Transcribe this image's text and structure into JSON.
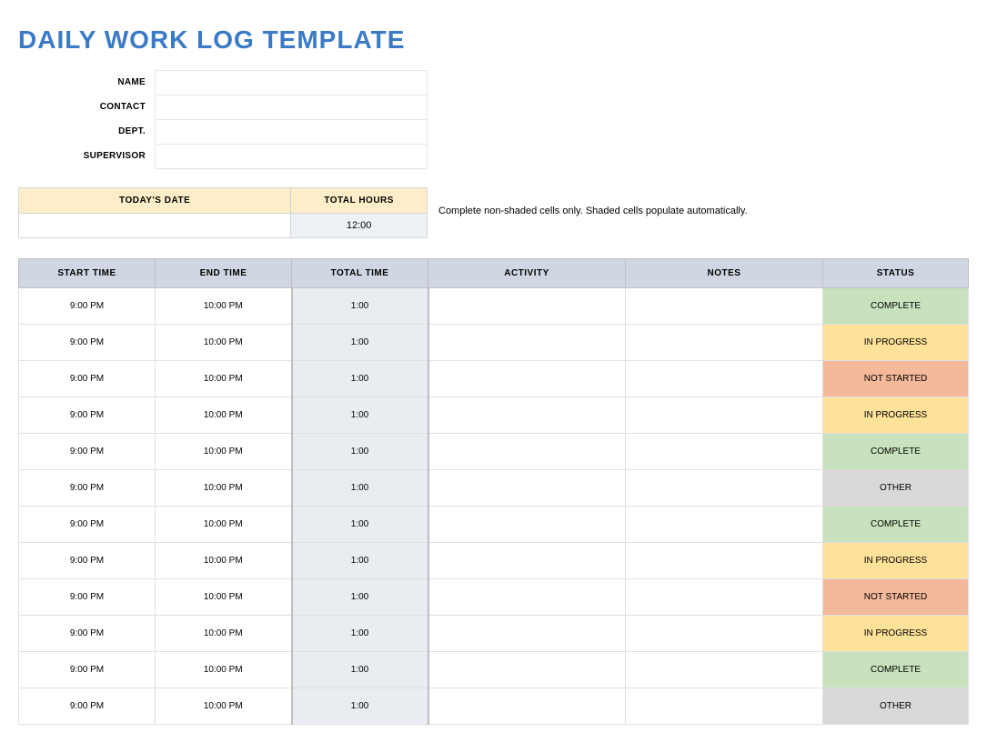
{
  "title": "DAILY WORK LOG TEMPLATE",
  "info": {
    "name_label": "NAME",
    "name_value": "",
    "contact_label": "CONTACT",
    "contact_value": "",
    "dept_label": "DEPT.",
    "dept_value": "",
    "supervisor_label": "SUPERVISOR",
    "supervisor_value": ""
  },
  "summary": {
    "date_header": "TODAY'S DATE",
    "hours_header": "TOTAL HOURS",
    "date_value": "",
    "hours_value": "12:00"
  },
  "helper_text": "Complete non-shaded cells only. Shaded cells populate automatically.",
  "log_headers": {
    "start": "START TIME",
    "end": "END TIME",
    "total": "TOTAL TIME",
    "activity": "ACTIVITY",
    "notes": "NOTES",
    "status": "STATUS"
  },
  "status_colors": {
    "COMPLETE": "#c8e2bd",
    "IN PROGRESS": "#ffe29a",
    "NOT STARTED": "#f4b89a",
    "OTHER": "#d9d9d9"
  },
  "log_rows": [
    {
      "start": "9:00 PM",
      "end": "10:00 PM",
      "total": "1:00",
      "activity": "",
      "notes": "",
      "status": "COMPLETE"
    },
    {
      "start": "9:00 PM",
      "end": "10:00 PM",
      "total": "1:00",
      "activity": "",
      "notes": "",
      "status": "IN PROGRESS"
    },
    {
      "start": "9:00 PM",
      "end": "10:00 PM",
      "total": "1:00",
      "activity": "",
      "notes": "",
      "status": "NOT STARTED"
    },
    {
      "start": "9:00 PM",
      "end": "10:00 PM",
      "total": "1:00",
      "activity": "",
      "notes": "",
      "status": "IN PROGRESS"
    },
    {
      "start": "9:00 PM",
      "end": "10:00 PM",
      "total": "1:00",
      "activity": "",
      "notes": "",
      "status": "COMPLETE"
    },
    {
      "start": "9:00 PM",
      "end": "10:00 PM",
      "total": "1:00",
      "activity": "",
      "notes": "",
      "status": "OTHER"
    },
    {
      "start": "9:00 PM",
      "end": "10:00 PM",
      "total": "1:00",
      "activity": "",
      "notes": "",
      "status": "COMPLETE"
    },
    {
      "start": "9:00 PM",
      "end": "10:00 PM",
      "total": "1:00",
      "activity": "",
      "notes": "",
      "status": "IN PROGRESS"
    },
    {
      "start": "9:00 PM",
      "end": "10:00 PM",
      "total": "1:00",
      "activity": "",
      "notes": "",
      "status": "NOT STARTED"
    },
    {
      "start": "9:00 PM",
      "end": "10:00 PM",
      "total": "1:00",
      "activity": "",
      "notes": "",
      "status": "IN PROGRESS"
    },
    {
      "start": "9:00 PM",
      "end": "10:00 PM",
      "total": "1:00",
      "activity": "",
      "notes": "",
      "status": "COMPLETE"
    },
    {
      "start": "9:00 PM",
      "end": "10:00 PM",
      "total": "1:00",
      "activity": "",
      "notes": "",
      "status": "OTHER"
    }
  ]
}
